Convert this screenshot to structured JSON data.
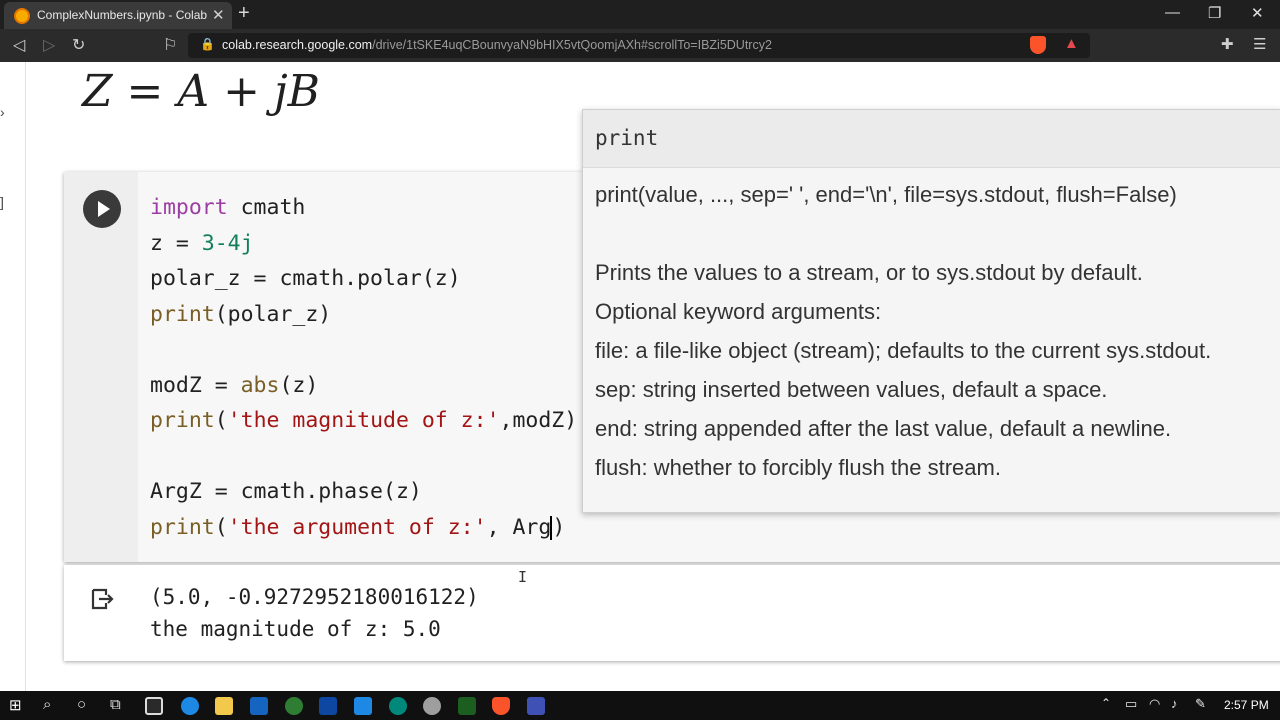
{
  "browser": {
    "tab_title": "ComplexNumbers.ipynb - Colaboratory",
    "tab_close": "✕",
    "new_tab": "+",
    "url_host": "colab.research.google.com",
    "url_path": "/drive/1tSKE4uqCBounvyaN9bHIX5vtQoomjAXh#scrollTo=IBZi5DUtrcy2",
    "window_controls": {
      "minimize": "—",
      "maximize": "❐",
      "close": "✕"
    }
  },
  "notebook": {
    "formula": "Z = A + jB",
    "code_lines": [
      "import cmath",
      "z = 3-4j",
      "polar_z = cmath.polar(z)",
      "print(polar_z)",
      "",
      "modZ = abs(z)",
      "print('the magnitude of z:',modZ)",
      "",
      "ArgZ = cmath.phase(z)",
      "print('the argument of z:', Arg)"
    ],
    "output_lines": [
      "(5.0, -0.9272952180016122)",
      "the magnitude of z: 5.0"
    ]
  },
  "tooltip": {
    "name": "print",
    "signature": "print(value, ..., sep=' ', end='\\n', file=sys.stdout, flush=False)",
    "doc_lines": [
      "Prints the values to a stream, or to sys.stdout by default.",
      "Optional keyword arguments:",
      "file:  a file-like object (stream); defaults to the current sys.stdout.",
      "sep:   string inserted between values, default a space.",
      "end:   string appended after the last value, default a newline.",
      "flush: whether to forcibly flush the stream."
    ]
  },
  "taskbar": {
    "time": "2:57 PM"
  },
  "colors": {
    "keyword": "#9c3da4",
    "number": "#11805a",
    "function": "#795e26",
    "string": "#a31515"
  }
}
